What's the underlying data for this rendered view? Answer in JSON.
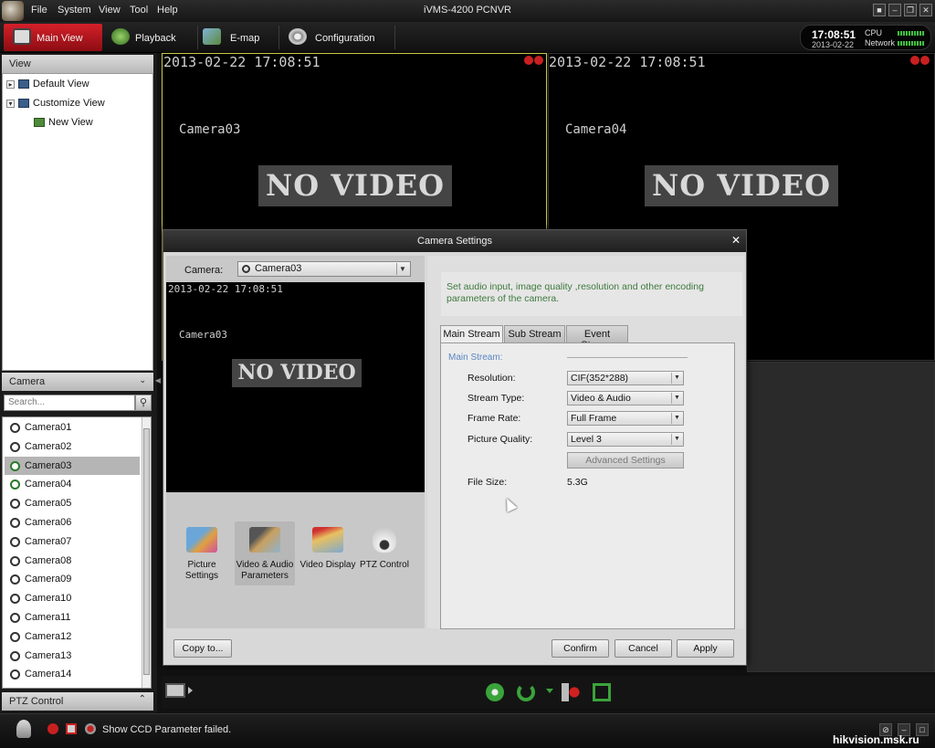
{
  "menu": {
    "items": [
      "File",
      "System",
      "View",
      "Tool",
      "Help"
    ],
    "title": "iVMS-4200 PCNVR"
  },
  "toolbar": {
    "tabs": [
      "Main View",
      "Playback",
      "E-map",
      "Configuration"
    ]
  },
  "clock": {
    "time": "17:08:51",
    "date": "2013-02-22",
    "cpu_label": "CPU",
    "network_label": "Network"
  },
  "left_panel": {
    "view_header": "View",
    "tree": [
      "Default View",
      "Customize View",
      "New View"
    ],
    "camera_header": "Camera",
    "search_placeholder": "Search...",
    "cameras": [
      "Camera01",
      "Camera02",
      "Camera03",
      "Camera04",
      "Camera05",
      "Camera06",
      "Camera07",
      "Camera08",
      "Camera09",
      "Camera10",
      "Camera11",
      "Camera12",
      "Camera13",
      "Camera14"
    ],
    "selected_camera": "Camera03",
    "ptz_header": "PTZ Control"
  },
  "video": {
    "tiles": [
      {
        "timestamp": "2013-02-22 17:08:51",
        "camera": "Camera03",
        "status": "NO VIDEO"
      },
      {
        "timestamp": "2013-02-22 17:08:51",
        "camera": "Camera04",
        "status": "NO VIDEO"
      }
    ]
  },
  "dialog": {
    "title": "Camera Settings",
    "camera_label": "Camera:",
    "camera_value": "Camera03",
    "preview_timestamp": "2013-02-22 17:08:51",
    "preview_camera": "Camera03",
    "preview_status": "NO VIDEO",
    "functions": [
      "Picture Settings",
      "Video & Audio Parameters",
      "Video Display",
      "PTZ Control"
    ],
    "info_text": "Set audio input, image quality ,resolution and other encoding parameters of the camera.",
    "stream_tabs": [
      "Main Stream",
      "Sub Stream",
      "Event Stream"
    ],
    "stream_caption": "Main Stream:",
    "fields": {
      "resolution_label": "Resolution:",
      "resolution_value": "CIF(352*288)",
      "stream_type_label": "Stream Type:",
      "stream_type_value": "Video & Audio",
      "frame_rate_label": "Frame Rate:",
      "frame_rate_value": "Full Frame",
      "picture_quality_label": "Picture Quality:",
      "picture_quality_value": "Level 3",
      "advanced_label": "Advanced Settings",
      "file_size_label": "File Size:",
      "file_size_value": "5.3G"
    },
    "buttons": {
      "copy_to": "Copy to...",
      "confirm": "Confirm",
      "cancel": "Cancel",
      "apply": "Apply"
    }
  },
  "status": {
    "message": "Show CCD Parameter failed.",
    "watermark": "hikvision.msk.ru"
  }
}
